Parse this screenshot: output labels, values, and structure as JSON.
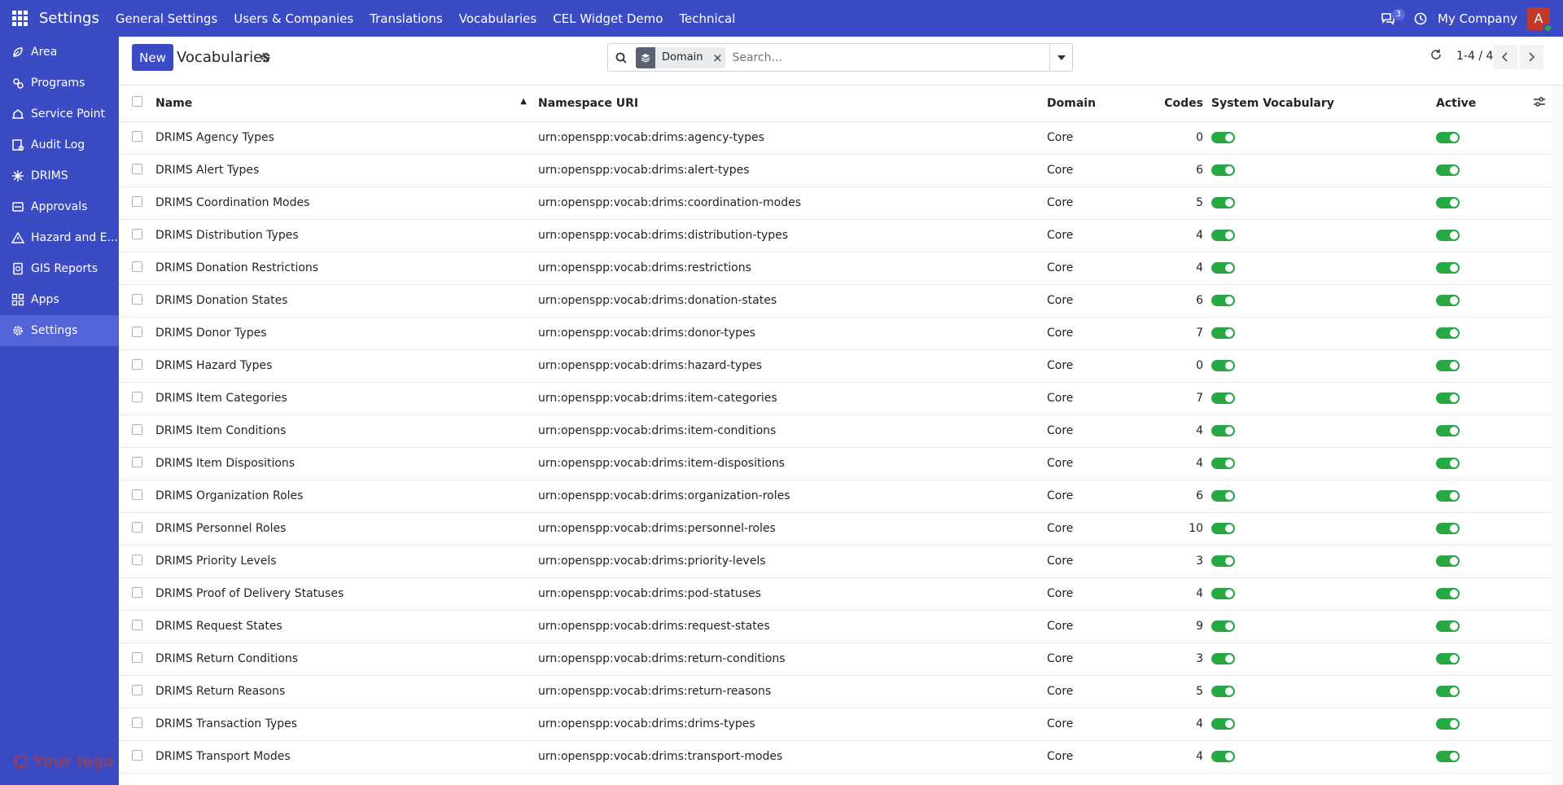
{
  "navbar": {
    "app_name": "Settings",
    "menu": [
      "General Settings",
      "Users & Companies",
      "Translations",
      "Vocabularies",
      "CEL Widget Demo",
      "Technical"
    ],
    "chat_badge": "3",
    "company": "My Company",
    "avatar_letter": "A"
  },
  "sidebar": {
    "items": [
      {
        "label": "Area",
        "icon": "leaf-icon"
      },
      {
        "label": "Programs",
        "icon": "programs-icon"
      },
      {
        "label": "Service Point",
        "icon": "service-point-icon"
      },
      {
        "label": "Audit Log",
        "icon": "audit-log-icon"
      },
      {
        "label": "DRIMS",
        "icon": "drims-icon"
      },
      {
        "label": "Approvals",
        "icon": "approvals-icon"
      },
      {
        "label": "Hazard and E...",
        "icon": "hazard-icon"
      },
      {
        "label": "GIS Reports",
        "icon": "gis-reports-icon"
      },
      {
        "label": "Apps",
        "icon": "apps-icon"
      },
      {
        "label": "Settings",
        "icon": "settings-icon"
      }
    ],
    "active_index": 9,
    "logo_text": "Your logo"
  },
  "control": {
    "new_label": "New",
    "title": "Vocabularies",
    "facet_label": "Domain",
    "search_placeholder": "Search...",
    "pager": "1-4 / 4"
  },
  "table": {
    "columns": {
      "name": "Name",
      "namespace": "Namespace URI",
      "domain": "Domain",
      "codes": "Codes",
      "system": "System Vocabulary",
      "active": "Active"
    },
    "rows": [
      {
        "name": "DRIMS Agency Types",
        "ns": "urn:openspp:vocab:drims:agency-types",
        "domain": "Core",
        "codes": "0",
        "system": true,
        "active": true
      },
      {
        "name": "DRIMS Alert Types",
        "ns": "urn:openspp:vocab:drims:alert-types",
        "domain": "Core",
        "codes": "6",
        "system": true,
        "active": true
      },
      {
        "name": "DRIMS Coordination Modes",
        "ns": "urn:openspp:vocab:drims:coordination-modes",
        "domain": "Core",
        "codes": "5",
        "system": true,
        "active": true
      },
      {
        "name": "DRIMS Distribution Types",
        "ns": "urn:openspp:vocab:drims:distribution-types",
        "domain": "Core",
        "codes": "4",
        "system": true,
        "active": true
      },
      {
        "name": "DRIMS Donation Restrictions",
        "ns": "urn:openspp:vocab:drims:restrictions",
        "domain": "Core",
        "codes": "4",
        "system": true,
        "active": true
      },
      {
        "name": "DRIMS Donation States",
        "ns": "urn:openspp:vocab:drims:donation-states",
        "domain": "Core",
        "codes": "6",
        "system": true,
        "active": true
      },
      {
        "name": "DRIMS Donor Types",
        "ns": "urn:openspp:vocab:drims:donor-types",
        "domain": "Core",
        "codes": "7",
        "system": true,
        "active": true
      },
      {
        "name": "DRIMS Hazard Types",
        "ns": "urn:openspp:vocab:drims:hazard-types",
        "domain": "Core",
        "codes": "0",
        "system": true,
        "active": true
      },
      {
        "name": "DRIMS Item Categories",
        "ns": "urn:openspp:vocab:drims:item-categories",
        "domain": "Core",
        "codes": "7",
        "system": true,
        "active": true
      },
      {
        "name": "DRIMS Item Conditions",
        "ns": "urn:openspp:vocab:drims:item-conditions",
        "domain": "Core",
        "codes": "4",
        "system": true,
        "active": true
      },
      {
        "name": "DRIMS Item Dispositions",
        "ns": "urn:openspp:vocab:drims:item-dispositions",
        "domain": "Core",
        "codes": "4",
        "system": true,
        "active": true
      },
      {
        "name": "DRIMS Organization Roles",
        "ns": "urn:openspp:vocab:drims:organization-roles",
        "domain": "Core",
        "codes": "6",
        "system": true,
        "active": true
      },
      {
        "name": "DRIMS Personnel Roles",
        "ns": "urn:openspp:vocab:drims:personnel-roles",
        "domain": "Core",
        "codes": "10",
        "system": true,
        "active": true
      },
      {
        "name": "DRIMS Priority Levels",
        "ns": "urn:openspp:vocab:drims:priority-levels",
        "domain": "Core",
        "codes": "3",
        "system": true,
        "active": true
      },
      {
        "name": "DRIMS Proof of Delivery Statuses",
        "ns": "urn:openspp:vocab:drims:pod-statuses",
        "domain": "Core",
        "codes": "4",
        "system": true,
        "active": true
      },
      {
        "name": "DRIMS Request States",
        "ns": "urn:openspp:vocab:drims:request-states",
        "domain": "Core",
        "codes": "9",
        "system": true,
        "active": true
      },
      {
        "name": "DRIMS Return Conditions",
        "ns": "urn:openspp:vocab:drims:return-conditions",
        "domain": "Core",
        "codes": "3",
        "system": true,
        "active": true
      },
      {
        "name": "DRIMS Return Reasons",
        "ns": "urn:openspp:vocab:drims:return-reasons",
        "domain": "Core",
        "codes": "5",
        "system": true,
        "active": true
      },
      {
        "name": "DRIMS Transaction Types",
        "ns": "urn:openspp:vocab:drims:drims-types",
        "domain": "Core",
        "codes": "4",
        "system": true,
        "active": true
      },
      {
        "name": "DRIMS Transport Modes",
        "ns": "urn:openspp:vocab:drims:transport-modes",
        "domain": "Core",
        "codes": "4",
        "system": true,
        "active": true
      }
    ]
  },
  "colors": {
    "primary": "#3b4bc4",
    "toggle_on": "#28a745",
    "logo": "#c0392b"
  }
}
